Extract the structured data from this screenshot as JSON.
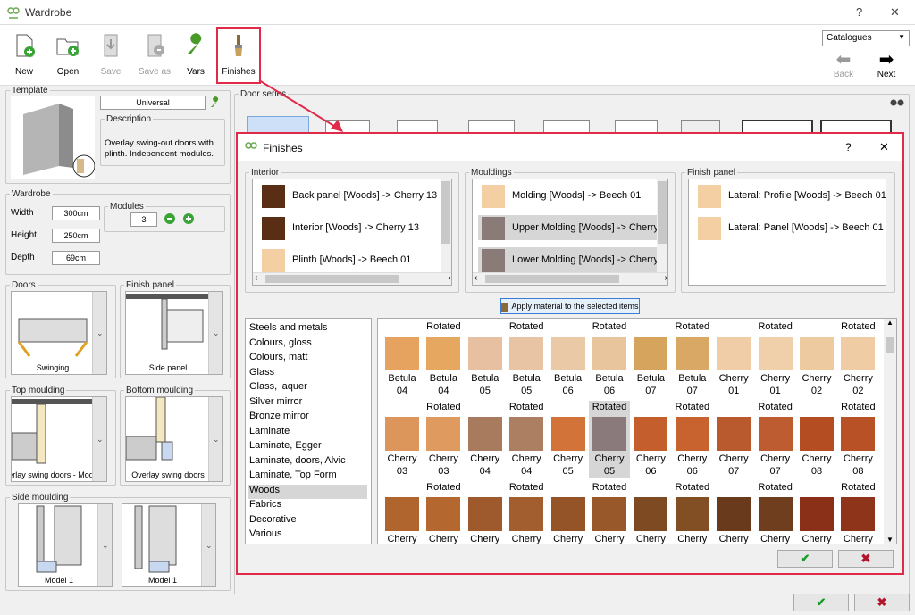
{
  "window": {
    "title": "Wardrobe",
    "help": "?",
    "close": "✕"
  },
  "toolbar": {
    "new": "New",
    "open": "Open",
    "save": "Save",
    "save_as": "Save as",
    "vars": "Vars",
    "finishes": "Finishes"
  },
  "catalogues": {
    "selected": "Catalogues"
  },
  "nav": {
    "back": "Back",
    "next": "Next"
  },
  "template": {
    "legend": "Template",
    "name": "Universal",
    "description_legend": "Description",
    "description": "Overlay swing-out doors with plinth. Independent modules."
  },
  "wardrobe": {
    "legend": "Wardrobe",
    "width_label": "Width",
    "width": "300cm",
    "height_label": "Height",
    "height": "250cm",
    "depth_label": "Depth",
    "depth": "69cm",
    "modules_legend": "Modules",
    "modules": "3"
  },
  "doors": {
    "legend": "Doors",
    "caption": "Swinging"
  },
  "finish_panel": {
    "legend": "Finish panel",
    "caption": "Side panel"
  },
  "top_moulding": {
    "legend": "Top moulding",
    "caption": "erlay swing doors - Mod"
  },
  "bottom_moulding": {
    "legend": "Bottom moulding",
    "caption": "Overlay swing doors"
  },
  "side_moulding": {
    "legend": "Side moulding",
    "caption_left": "Model 1",
    "caption_right": "Model 1"
  },
  "door_series": {
    "legend": "Door series"
  },
  "finishes": {
    "title": "Finishes",
    "help": "?",
    "close": "✕",
    "interior": {
      "legend": "Interior",
      "items": [
        {
          "label": "Back panel [Woods] -> Cherry 13",
          "color": "#5a2e14"
        },
        {
          "label": "Interior [Woods] -> Cherry 13",
          "color": "#5a2e14"
        },
        {
          "label": "Plinth [Woods] -> Beech 01",
          "color": "#f3cfa3"
        }
      ]
    },
    "mouldings": {
      "legend": "Mouldings",
      "items": [
        {
          "label": "Molding [Woods] -> Beech 01",
          "color": "#f3cfa3"
        },
        {
          "label": "Upper Molding [Woods] -> Cherry",
          "color": "#8a7a78"
        },
        {
          "label": "Lower Molding [Woods] -> Cherry",
          "color": "#8a7a78"
        }
      ]
    },
    "finish_panel": {
      "legend": "Finish panel",
      "items": [
        {
          "label": "Lateral: Profile [Woods] -> Beech 01",
          "color": "#f3cfa3"
        },
        {
          "label": "Lateral: Panel [Woods] -> Beech 01",
          "color": "#f3cfa3"
        }
      ]
    },
    "apply_button": "Apply material to the selected items",
    "categories": [
      "Steels and metals",
      "Colours, gloss",
      "Colours, matt",
      "Glass",
      "Glass, laquer",
      "Silver mirror",
      "Bronze mirror",
      "Laminate",
      "Laminate, Egger",
      "Laminate, doors, Alvic",
      "Laminate, Top Form",
      "Woods",
      "Fabrics",
      "Decorative",
      "Various"
    ],
    "active_category": "Woods",
    "materials_row1": [
      {
        "rot": "",
        "l1": "Betula",
        "l2": "04",
        "color": "#e6a35f"
      },
      {
        "rot": "Rotated",
        "l1": "Betula",
        "l2": "04",
        "color": "#e6a860"
      },
      {
        "rot": "",
        "l1": "Betula",
        "l2": "05",
        "color": "#e6c0a0"
      },
      {
        "rot": "Rotated",
        "l1": "Betula",
        "l2": "05",
        "color": "#e8c4a4"
      },
      {
        "rot": "",
        "l1": "Betula",
        "l2": "06",
        "color": "#eac9a6"
      },
      {
        "rot": "Rotated",
        "l1": "Betula",
        "l2": "06",
        "color": "#e9c59e"
      },
      {
        "rot": "",
        "l1": "Betula",
        "l2": "07",
        "color": "#d6a45c"
      },
      {
        "rot": "Rotated",
        "l1": "Betula",
        "l2": "07",
        "color": "#d9a864"
      },
      {
        "rot": "",
        "l1": "Cherry",
        "l2": "01",
        "color": "#f0cda6"
      },
      {
        "rot": "Rotated",
        "l1": "Cherry",
        "l2": "01",
        "color": "#f0d0aa"
      },
      {
        "rot": "",
        "l1": "Cherry",
        "l2": "02",
        "color": "#eecaa0"
      },
      {
        "rot": "Rotated",
        "l1": "Cherry",
        "l2": "02",
        "color": "#efcca4"
      }
    ],
    "materials_row2": [
      {
        "rot": "",
        "l1": "Cherry",
        "l2": "03",
        "color": "#dc955a"
      },
      {
        "rot": "Rotated",
        "l1": "Cherry",
        "l2": "03",
        "color": "#df9a60"
      },
      {
        "rot": "",
        "l1": "Cherry",
        "l2": "04",
        "color": "#a87a5e"
      },
      {
        "rot": "Rotated",
        "l1": "Cherry",
        "l2": "04",
        "color": "#ac7e62"
      },
      {
        "rot": "",
        "l1": "Cherry",
        "l2": "05",
        "color": "#d2743a"
      },
      {
        "rot": "Rotated",
        "l1": "Cherry",
        "l2": "05",
        "color": "#8a7a7c"
      },
      {
        "rot": "",
        "l1": "Cherry",
        "l2": "06",
        "color": "#c45e2c"
      },
      {
        "rot": "Rotated",
        "l1": "Cherry",
        "l2": "06",
        "color": "#c8622e"
      },
      {
        "rot": "",
        "l1": "Cherry",
        "l2": "07",
        "color": "#b9592e"
      },
      {
        "rot": "Rotated",
        "l1": "Cherry",
        "l2": "07",
        "color": "#bc5c30"
      },
      {
        "rot": "",
        "l1": "Cherry",
        "l2": "08",
        "color": "#b44e22"
      },
      {
        "rot": "Rotated",
        "l1": "Cherry",
        "l2": "08",
        "color": "#b85226"
      }
    ],
    "materials_row3": [
      {
        "rot": "",
        "l1": "Cherry",
        "color": "#b0642e"
      },
      {
        "rot": "Rotated",
        "l1": "Cherry",
        "color": "#b4682f"
      },
      {
        "rot": "",
        "l1": "Cherry",
        "color": "#9e5a2c"
      },
      {
        "rot": "Rotated",
        "l1": "Cherry",
        "color": "#a25e2e"
      },
      {
        "rot": "",
        "l1": "Cherry",
        "color": "#955428"
      },
      {
        "rot": "Rotated",
        "l1": "Cherry",
        "color": "#99582a"
      },
      {
        "rot": "",
        "l1": "Cherry",
        "color": "#7e4a22"
      },
      {
        "rot": "Rotated",
        "l1": "Cherry",
        "color": "#824e24"
      },
      {
        "rot": "",
        "l1": "Cherry",
        "color": "#6a3a1c"
      },
      {
        "rot": "Rotated",
        "l1": "Cherry",
        "color": "#6e3e1e"
      },
      {
        "rot": "",
        "l1": "Cherry",
        "color": "#8a3018"
      },
      {
        "rot": "Rotated",
        "l1": "Cherry",
        "color": "#8e341a"
      }
    ],
    "ok": "✔",
    "cancel": "✖"
  },
  "footer": {
    "ok": "✔",
    "cancel": "✖"
  },
  "colors": {
    "accent_red": "#e02a4a",
    "ok_green": "#1a9a2a",
    "cancel_red": "#b3152a"
  }
}
